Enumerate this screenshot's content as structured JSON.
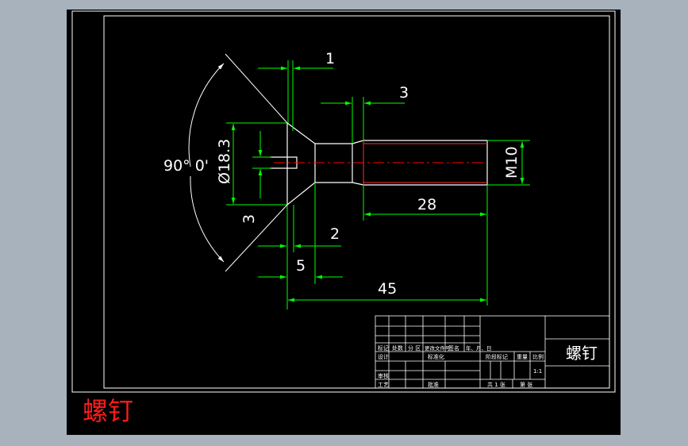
{
  "drawing": {
    "colors": {
      "background": "#000000",
      "frame": "#ffffff",
      "dimension": "#00ff00",
      "centerline": "#ff0000",
      "viewport": "#a7b2bd",
      "caption": "#ff1a1a"
    },
    "dimensions": {
      "d1": "1",
      "d3_top": "3",
      "d_head": "Ø18.3",
      "d3_left": "3",
      "angle": "90° 0'",
      "d_m10": "M10",
      "d28": "28",
      "d2": "2",
      "d5": "5",
      "d45": "45"
    },
    "title_block": {
      "part_name": "螺钉",
      "row_labels": {
        "marker": "标记",
        "count": "处数",
        "zone": "分 区",
        "change_doc": "更改文件号",
        "signature": "签名",
        "date": "年、月、日",
        "design": "设计",
        "standardize": "标准化",
        "review": "审核",
        "process": "工艺",
        "approve": "批准"
      },
      "info_labels": {
        "stage_mark": "阶段标记",
        "weight": "重量",
        "scale": "比例",
        "scale_value": "1:1",
        "sheets_total": "共 1 张",
        "sheet_no": "第 张"
      }
    }
  },
  "caption": "螺钉"
}
